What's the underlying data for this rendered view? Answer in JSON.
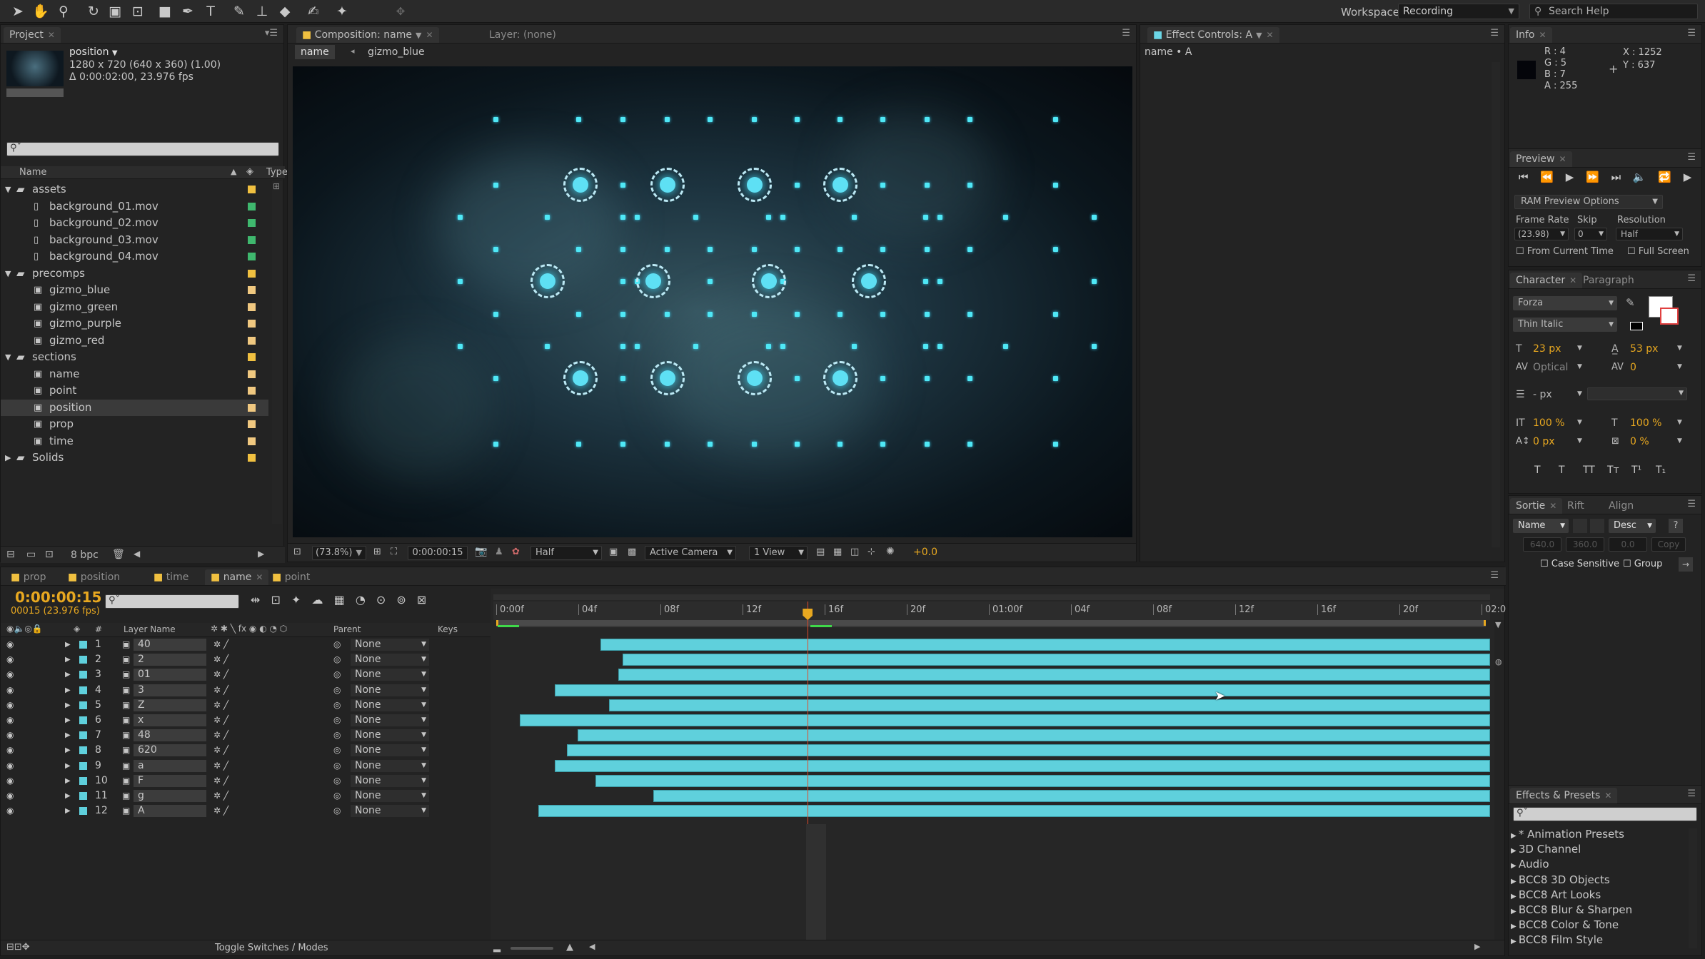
{
  "workspace": {
    "label": "Workspace:",
    "value": "Recording",
    "search_placeholder": "Search Help"
  },
  "project": {
    "tab": "Project",
    "item_name": "position",
    "item_info1": "1280 x 720  (640 x 360) (1.00)",
    "item_info2": "Δ 0:00:02:00, 23.976 fps",
    "col_name": "Name",
    "col_type": "Type",
    "tree": [
      {
        "name": "assets",
        "kind": "folder",
        "depth": 0,
        "label": "#f0c040"
      },
      {
        "name": "background_01.mov",
        "kind": "file",
        "depth": 1,
        "label": "#3fb86e"
      },
      {
        "name": "background_02.mov",
        "kind": "file",
        "depth": 1,
        "label": "#3fb86e"
      },
      {
        "name": "background_03.mov",
        "kind": "file",
        "depth": 1,
        "label": "#3fb86e"
      },
      {
        "name": "background_04.mov",
        "kind": "file",
        "depth": 1,
        "label": "#3fb86e"
      },
      {
        "name": "precomps",
        "kind": "folder",
        "depth": 0,
        "label": "#f0c040"
      },
      {
        "name": "gizmo_blue",
        "kind": "comp",
        "depth": 1,
        "label": "#f0c880"
      },
      {
        "name": "gizmo_green",
        "kind": "comp",
        "depth": 1,
        "label": "#f0c880"
      },
      {
        "name": "gizmo_purple",
        "kind": "comp",
        "depth": 1,
        "label": "#f0c880"
      },
      {
        "name": "gizmo_red",
        "kind": "comp",
        "depth": 1,
        "label": "#f0c880"
      },
      {
        "name": "sections",
        "kind": "folder",
        "depth": 0,
        "label": "#f0c040"
      },
      {
        "name": "name",
        "kind": "comp",
        "depth": 1,
        "label": "#f0c880"
      },
      {
        "name": "point",
        "kind": "comp",
        "depth": 1,
        "label": "#f0c880"
      },
      {
        "name": "position",
        "kind": "comp",
        "depth": 1,
        "label": "#f0c880",
        "selected": true
      },
      {
        "name": "prop",
        "kind": "comp",
        "depth": 1,
        "label": "#f0c880"
      },
      {
        "name": "time",
        "kind": "comp",
        "depth": 1,
        "label": "#f0c880"
      },
      {
        "name": "Solids",
        "kind": "folder",
        "depth": 0,
        "label": "#f0c040"
      }
    ],
    "bpc": "8 bpc"
  },
  "composition": {
    "tab": "Composition: name",
    "layer_tab": "Layer: (none)",
    "crumb1": "name",
    "crumb2": "gizmo_blue",
    "zoom": "(73.8%)",
    "timecode": "0:00:00:15",
    "resolution": "Half",
    "camera": "Active Camera",
    "views": "1 View",
    "exposure": "+0.0"
  },
  "effect_controls": {
    "tab": "Effect Controls: A",
    "path": "name • A"
  },
  "info": {
    "tab": "Info",
    "r": "R : 4",
    "g": "G : 5",
    "b": "B : 7",
    "a": "A : 255",
    "x": "X : 1252",
    "y": "Y : 637"
  },
  "preview": {
    "tab": "Preview",
    "ram_options": "RAM Preview Options",
    "frame_rate_label": "Frame Rate",
    "skip_label": "Skip",
    "resolution_label": "Resolution",
    "frame_rate": "(23.98)",
    "skip": "0",
    "resolution": "Half",
    "from_current": "From Current Time",
    "full_screen": "Full Screen"
  },
  "character": {
    "tab": "Character",
    "tab2": "Paragraph",
    "font": "Forza",
    "style": "Thin Italic",
    "size": "23 px",
    "leading": "53 px",
    "kerning": "Optical",
    "tracking": "0",
    "stroke": "- px",
    "vscale": "100 %",
    "hscale": "100 %",
    "baseline": "0 px",
    "tsume": "0 %",
    "styles": [
      "T",
      "T",
      "TT",
      "Tт",
      "T¹",
      "T₁"
    ]
  },
  "sortie": {
    "tab": "Sortie",
    "tab2": "Rift",
    "tab3": "Align",
    "name": "Name",
    "desc": "Desc",
    "help": "?",
    "v1": "640.0",
    "v2": "360.0",
    "v3": "0.0",
    "copy": "Copy",
    "case_sensitive": "Case Sensitive",
    "group": "Group"
  },
  "effects": {
    "tab": "Effects & Presets",
    "items": [
      "* Animation Presets",
      "3D Channel",
      "Audio",
      "BCC8 3D Objects",
      "BCC8 Art Looks",
      "BCC8 Blur & Sharpen",
      "BCC8 Color & Tone",
      "BCC8 Film Style"
    ]
  },
  "timeline": {
    "tabs": [
      {
        "name": "prop"
      },
      {
        "name": "position"
      },
      {
        "name": "time"
      },
      {
        "name": "name",
        "active": true
      },
      {
        "name": "point"
      }
    ],
    "timecode": "0:00:00:15",
    "fps": "00015 (23.976 fps)",
    "col_layer_name": "Layer Name",
    "col_parent": "Parent",
    "col_keys": "Keys",
    "col_num": "#",
    "ruler": [
      "0:00f",
      "04f",
      "08f",
      "12f",
      "16f",
      "20f",
      "01:00f",
      "04f",
      "08f",
      "12f",
      "16f",
      "20f",
      "02:0"
    ],
    "layers": [
      {
        "num": "1",
        "name": "40",
        "parent": "None",
        "start": 0.105
      },
      {
        "num": "2",
        "name": "2",
        "parent": "None",
        "start": 0.127
      },
      {
        "num": "3",
        "name": "01",
        "parent": "None",
        "start": 0.123
      },
      {
        "num": "4",
        "name": "3",
        "parent": "None",
        "start": 0.059
      },
      {
        "num": "5",
        "name": "Z",
        "parent": "None",
        "start": 0.113
      },
      {
        "num": "6",
        "name": "x",
        "parent": "None",
        "start": 0.024
      },
      {
        "num": "7",
        "name": "48",
        "parent": "None",
        "start": 0.082
      },
      {
        "num": "8",
        "name": "620",
        "parent": "None",
        "start": 0.071
      },
      {
        "num": "9",
        "name": "a",
        "parent": "None",
        "start": 0.059
      },
      {
        "num": "10",
        "name": "F",
        "parent": "None",
        "start": 0.1
      },
      {
        "num": "11",
        "name": "g",
        "parent": "None",
        "start": 0.158
      },
      {
        "num": "12",
        "name": "A",
        "parent": "None",
        "start": 0.042
      }
    ],
    "playhead": 0.313,
    "toggle": "Toggle Switches / Modes"
  }
}
